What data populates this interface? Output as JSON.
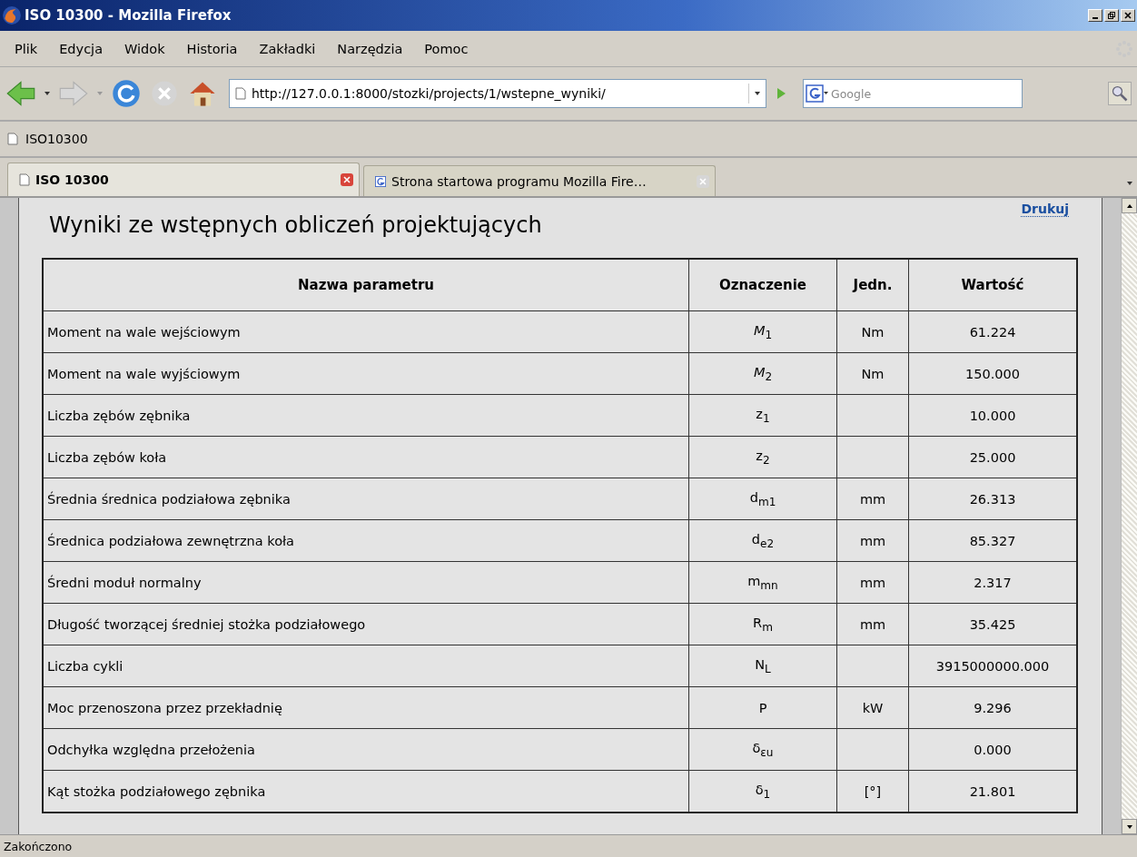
{
  "window": {
    "title": "ISO 10300 - Mozilla Firefox"
  },
  "menu": [
    "Plik",
    "Edycja",
    "Widok",
    "Historia",
    "Zakładki",
    "Narzędzia",
    "Pomoc"
  ],
  "address": {
    "value": "http://127.0.0.1:8000/stozki/projects/1/wstepne_wyniki/"
  },
  "search": {
    "placeholder": "Google"
  },
  "bookmarks": [
    "ISO10300"
  ],
  "tabs": [
    {
      "label": "ISO 10300",
      "selected": true
    },
    {
      "label": "Strona startowa programu Mozilla Fire…",
      "selected": false
    }
  ],
  "page": {
    "heading": "Wyniki ze wstępnych obliczeń projektujących",
    "print_link": "Drukuj",
    "table": {
      "columns": [
        "Nazwa parametru",
        "Oznaczenie",
        "Jedn.",
        "Wartość"
      ],
      "rows": [
        [
          "Moment na wale wejściowym",
          "*M*$_{1}$",
          "Nm",
          "61.224"
        ],
        [
          "Moment na wale wyjściowym",
          "*M*$_{2}$",
          "Nm",
          "150.000"
        ],
        [
          "Liczba zębów zębnika",
          "z$_{1}$",
          "",
          "10.000"
        ],
        [
          "Liczba zębów koła",
          "z$_{2}$",
          "",
          "25.000"
        ],
        [
          "Średnia średnica podziałowa zębnika",
          "d$_{m1}$",
          "mm",
          "26.313"
        ],
        [
          "Średnica podziałowa zewnętrzna koła",
          "d$_{e2}$",
          "mm",
          "85.327"
        ],
        [
          "Średni moduł normalny",
          "m$_{mn}$",
          "mm",
          "2.317"
        ],
        [
          "Długość tworzącej średniej stożka podziałowego",
          "R$_{m}$",
          "mm",
          "35.425"
        ],
        [
          "Liczba cykli",
          "N$_{L}$",
          "",
          "3915000000.000"
        ],
        [
          "Moc przenoszona przez przekładnię",
          "P",
          "kW",
          "9.296"
        ],
        [
          "Odchyłka względna przełożenia",
          "δ$_{εu}$",
          "",
          "0.000"
        ],
        [
          "Kąt stożka podziałowego zębnika",
          "δ$_{1}$",
          "[°]",
          "21.801"
        ]
      ]
    }
  },
  "status_bar": "Zakończono"
}
